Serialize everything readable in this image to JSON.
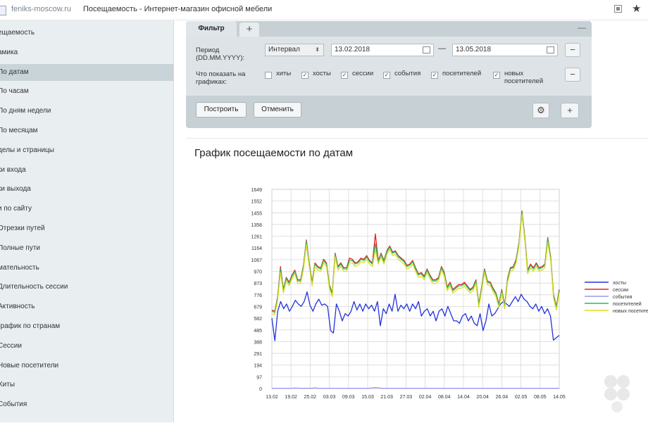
{
  "browser": {
    "domain": "feniks-moscow.ru",
    "title": "Посещаемость - Интернет-магазин офисной мебели"
  },
  "sidebar": {
    "items": [
      {
        "label": "ещаемость"
      },
      {
        "label": "амика"
      },
      {
        "label": "По датам"
      },
      {
        "label": "По часам"
      },
      {
        "label": "По дням недели"
      },
      {
        "label": "По месяцам"
      },
      {
        "label": "делы и страницы"
      },
      {
        "label": "ки входа"
      },
      {
        "label": "ки выхода"
      },
      {
        "label": "и по сайту"
      },
      {
        "label": "Отрезки путей"
      },
      {
        "label": "Полные пути"
      },
      {
        "label": "мательность"
      },
      {
        "label": "Длительность сессии"
      },
      {
        "label": "Активность"
      },
      {
        "label": "график по странам"
      },
      {
        "label": "Сессии"
      },
      {
        "label": "Новые посетители"
      },
      {
        "label": "Хиты"
      },
      {
        "label": "События"
      }
    ],
    "active_index": 2
  },
  "filter": {
    "tab_label": "Фильтр",
    "add_tab": "+",
    "collapse": "—",
    "period_label_1": "Период",
    "period_label_2": "(DD.MM.YYYY):",
    "interval_value": "Интервал",
    "date_from": "13.02.2018",
    "dash": "—",
    "date_to": "13.05.2018",
    "remove_row": "−",
    "show_label_1": "Что показать на",
    "show_label_2": "графиках:",
    "checkboxes": [
      {
        "label": "хиты",
        "checked": false
      },
      {
        "label": "хосты",
        "checked": true
      },
      {
        "label": "сессии",
        "checked": true
      },
      {
        "label": "события",
        "checked": true
      },
      {
        "label": "посетителей",
        "checked": true
      },
      {
        "label": "новых посетителей",
        "checked": true
      }
    ],
    "build_button": "Построить",
    "cancel_button": "Отменить",
    "add_button": "+"
  },
  "chart_panel": {
    "title": "График посещаемости по датам"
  },
  "chart_data": {
    "type": "line",
    "title": "График посещаемости по датам",
    "y_ticks": [
      0,
      97,
      194,
      291,
      388,
      485,
      582,
      679,
      776,
      873,
      970,
      1067,
      1164,
      1261,
      1358,
      1455,
      1552,
      1649
    ],
    "ylim": [
      0,
      1649
    ],
    "x_ticks": [
      "13.02",
      "19.02",
      "25.02",
      "03.03",
      "09.03",
      "15.03",
      "21.03",
      "27.03",
      "02.04",
      "08.04",
      "14.04",
      "20.04",
      "26.04",
      "02.05",
      "08.05",
      "14.05"
    ],
    "grid": true,
    "legend_position": "right",
    "colors": {
      "хосты": "#2233dd",
      "сессии": "#e52222",
      "события": "#9999ee",
      "посетителей": "#22bb66",
      "новых посетителей": "#dddd22"
    },
    "series": [
      {
        "name": "хосты",
        "values": [
          582,
          396,
          640,
          720,
          660,
          700,
          640,
          680,
          730,
          700,
          680,
          720,
          800,
          690,
          640,
          700,
          740,
          690,
          700,
          680,
          480,
          460,
          700,
          640,
          560,
          620,
          600,
          640,
          720,
          650,
          700,
          640,
          700,
          660,
          690,
          640,
          720,
          520,
          660,
          620,
          700,
          640,
          780,
          640,
          690,
          660,
          700,
          640,
          700,
          660,
          720,
          600,
          640,
          660,
          600,
          640,
          560,
          640,
          660,
          600,
          680,
          620,
          560,
          560,
          540,
          600,
          620,
          560,
          600,
          540,
          520,
          620,
          480,
          560,
          700,
          600,
          620,
          660,
          700,
          720,
          700,
          680,
          720,
          760,
          720,
          780,
          740,
          720,
          680,
          660,
          700,
          640,
          680,
          620,
          660,
          600,
          400,
          420,
          440
        ]
      },
      {
        "name": "сессии",
        "values": [
          650,
          640,
          760,
          1010,
          820,
          920,
          880,
          940,
          980,
          900,
          900,
          1020,
          1230,
          1040,
          880,
          1040,
          1010,
          1000,
          1070,
          1040,
          860,
          790,
          1120,
          1010,
          1040,
          1000,
          1000,
          1080,
          1070,
          1040,
          1050,
          1080,
          1070,
          1100,
          1060,
          1040,
          1280,
          1060,
          1120,
          1060,
          1140,
          1180,
          1130,
          1140,
          1100,
          1080,
          1060,
          1020,
          1030,
          1060,
          1000,
          950,
          960,
          930,
          990,
          940,
          900,
          900,
          920,
          1010,
          960,
          840,
          880,
          820,
          840,
          860,
          860,
          880,
          850,
          820,
          840,
          900,
          700,
          840,
          990,
          890,
          880,
          830,
          790,
          700,
          820,
          690,
          910,
          1000,
          1010,
          1070,
          1210,
          1470,
          1260,
          980,
          1030,
          1000,
          1040,
          1000,
          1010,
          1030,
          1250,
          1090,
          780,
          680,
          820
        ]
      },
      {
        "name": "события",
        "values": [
          2,
          2,
          2,
          2,
          2,
          2,
          2,
          2,
          4,
          3,
          2,
          2,
          3,
          2,
          2,
          6,
          2,
          2,
          2,
          2,
          2,
          2,
          2,
          2,
          2,
          2,
          2,
          2,
          2,
          2,
          2,
          2,
          2,
          2,
          2,
          6,
          8,
          6,
          2,
          2,
          2,
          2,
          2,
          2,
          2,
          2,
          2,
          2,
          2,
          2,
          2,
          2,
          2,
          2,
          2,
          2,
          2,
          2,
          2,
          2,
          2,
          2,
          2,
          2,
          2,
          2,
          2,
          2,
          2,
          2,
          2,
          2,
          2,
          2,
          2,
          2,
          2,
          2,
          2,
          2,
          2,
          2,
          2,
          2,
          2,
          2,
          2,
          2,
          2,
          2,
          2,
          2,
          2,
          2,
          2,
          2,
          2,
          2,
          2,
          2,
          2
        ]
      },
      {
        "name": "посетителей",
        "values": [
          640,
          630,
          750,
          990,
          810,
          910,
          870,
          930,
          970,
          890,
          890,
          1010,
          1220,
          1030,
          870,
          1030,
          1000,
          990,
          1060,
          1030,
          850,
          780,
          1110,
          1000,
          1030,
          990,
          990,
          1060,
          1060,
          1030,
          1040,
          1070,
          1060,
          1090,
          1050,
          1030,
          1200,
          1050,
          1110,
          1050,
          1130,
          1170,
          1120,
          1130,
          1090,
          1070,
          1050,
          1010,
          1020,
          1050,
          990,
          940,
          950,
          920,
          980,
          930,
          890,
          890,
          910,
          1000,
          950,
          830,
          870,
          810,
          830,
          850,
          850,
          870,
          840,
          810,
          830,
          890,
          690,
          830,
          980,
          880,
          870,
          820,
          780,
          690,
          810,
          680,
          900,
          990,
          1000,
          1060,
          1200,
          1460,
          1250,
          970,
          1020,
          990,
          1030,
          990,
          1000,
          1020,
          1240,
          1080,
          770,
          670,
          810
        ]
      },
      {
        "name": "новых посетителей",
        "values": [
          620,
          610,
          730,
          960,
          790,
          890,
          850,
          910,
          950,
          870,
          870,
          990,
          1190,
          1010,
          850,
          1010,
          980,
          970,
          1040,
          1010,
          830,
          760,
          1090,
          980,
          1010,
          970,
          970,
          1040,
          1040,
          1010,
          1020,
          1050,
          1040,
          1070,
          1030,
          1010,
          1150,
          1030,
          1090,
          1030,
          1110,
          1150,
          1100,
          1110,
          1070,
          1050,
          1030,
          990,
          1000,
          1030,
          970,
          920,
          930,
          900,
          960,
          910,
          870,
          870,
          890,
          980,
          930,
          810,
          850,
          790,
          810,
          830,
          830,
          850,
          820,
          790,
          810,
          870,
          670,
          810,
          960,
          860,
          850,
          800,
          760,
          670,
          790,
          660,
          880,
          970,
          980,
          1040,
          1180,
          1440,
          1230,
          950,
          1000,
          970,
          1010,
          970,
          980,
          1000,
          1210,
          1060,
          750,
          650,
          790
        ]
      }
    ]
  }
}
